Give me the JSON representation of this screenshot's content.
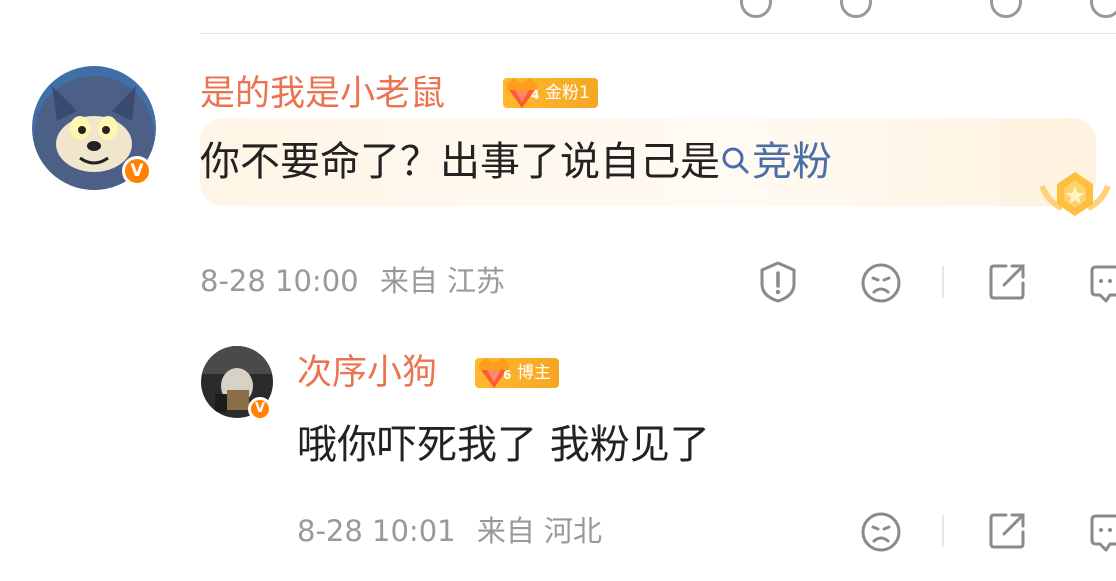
{
  "comment": {
    "username": "是的我是小老鼠",
    "badge_level": "4",
    "badge_label": "金粉1",
    "text": "你不要命了？出事了说自己是",
    "link_text": "竞粉",
    "timestamp": "8-28 10:00",
    "location": "来自 江苏"
  },
  "reply": {
    "username": "次序小狗",
    "badge_level": "6",
    "badge_label": "博主",
    "text": "哦你吓死我了 我粉见了",
    "timestamp": "8-28 10:01",
    "location": "来自 河北"
  },
  "verified_mark": "V",
  "icons": [
    "report-icon",
    "dislike-icon",
    "share-icon",
    "comment-icon",
    "search-icon",
    "crown-gem-icon",
    "award-medal-icon"
  ],
  "colors": {
    "username": "#eb7350",
    "badge": "#f5a623",
    "verified": "#ff8200",
    "link": "#4a6fa8",
    "meta": "#999999"
  }
}
